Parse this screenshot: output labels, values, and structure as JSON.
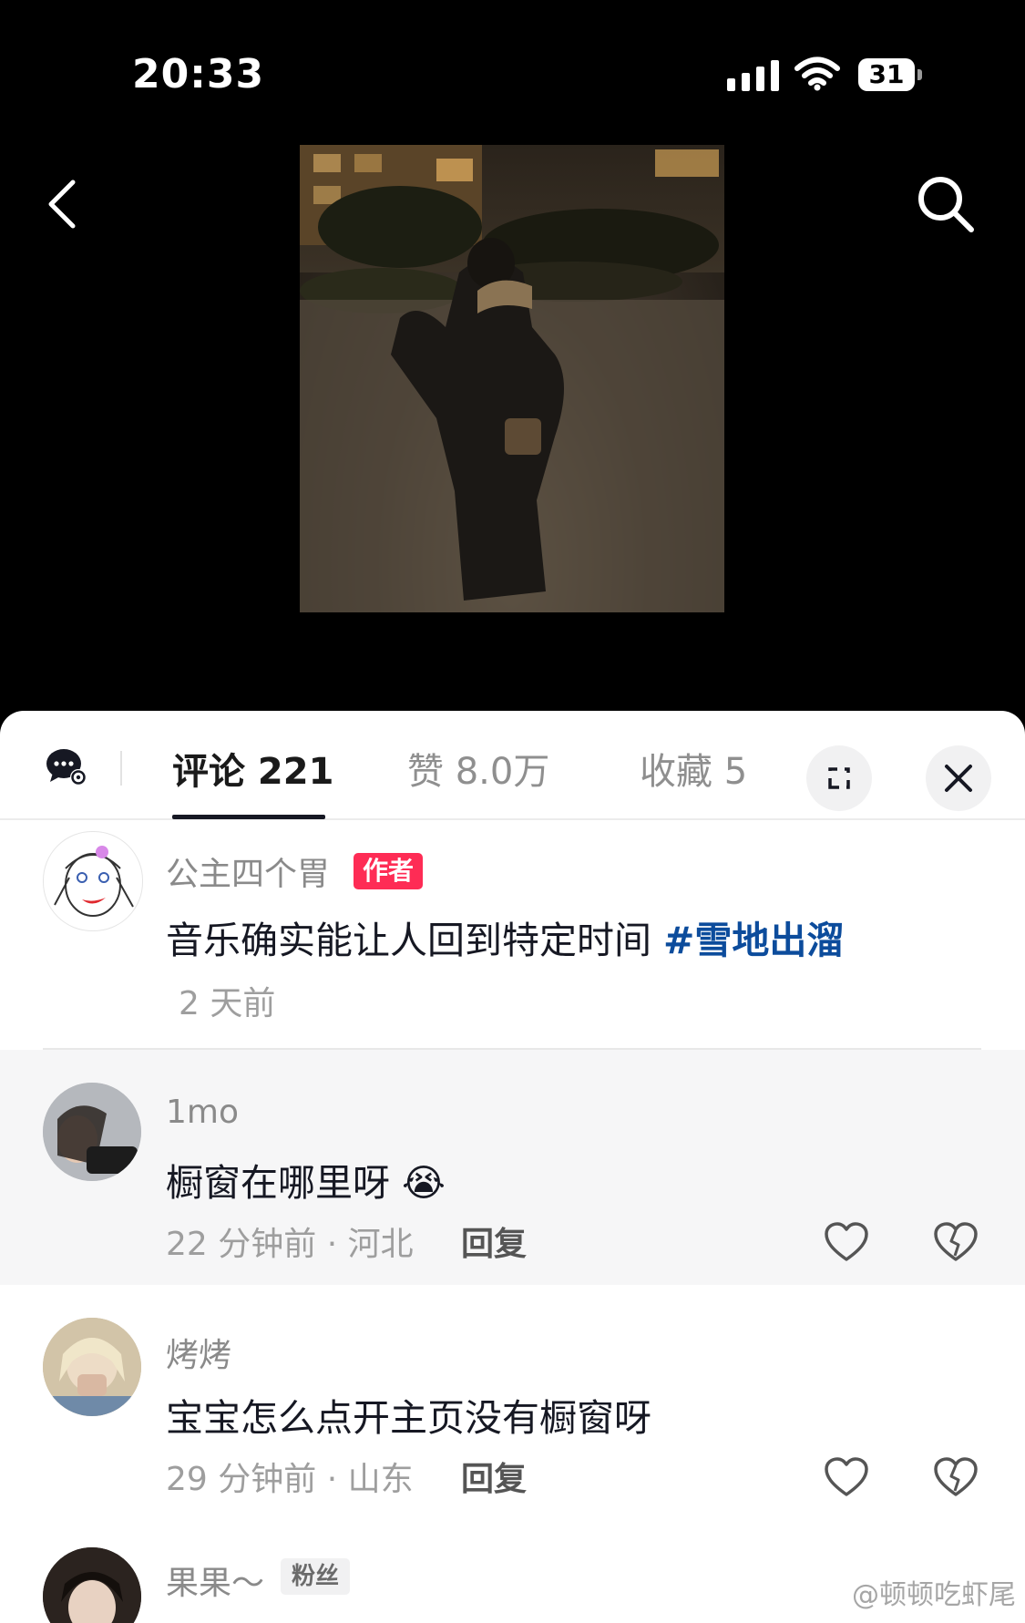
{
  "status_bar": {
    "time": "20:33",
    "battery": "31"
  },
  "tabs": [
    {
      "label": "评论 221",
      "active": true
    },
    {
      "label": "赞 8.0万",
      "active": false
    },
    {
      "label": "收藏 5",
      "active": false
    }
  ],
  "comments": [
    {
      "username": "公主四个胃",
      "badge": "作者",
      "text": "音乐确实能让人回到特定时间",
      "hashtag": "#雪地出溜",
      "meta": "2 天前"
    },
    {
      "username": "1mo",
      "text": "橱窗在哪里呀",
      "emoji": "😭",
      "meta": "22 分钟前 · 河北",
      "reply": "回复"
    },
    {
      "username": "烤烤",
      "text": "宝宝怎么点开主页没有橱窗呀",
      "meta": "29 分钟前 · 山东",
      "reply": "回复"
    },
    {
      "username": "果果～",
      "badge": "粉丝"
    }
  ],
  "watermark": "@顿顿吃虾尾",
  "colors": {
    "accent_red": "#fe2c55",
    "hashtag_blue": "#0c4c9c",
    "highlight_bg": "#f6f6f7"
  }
}
